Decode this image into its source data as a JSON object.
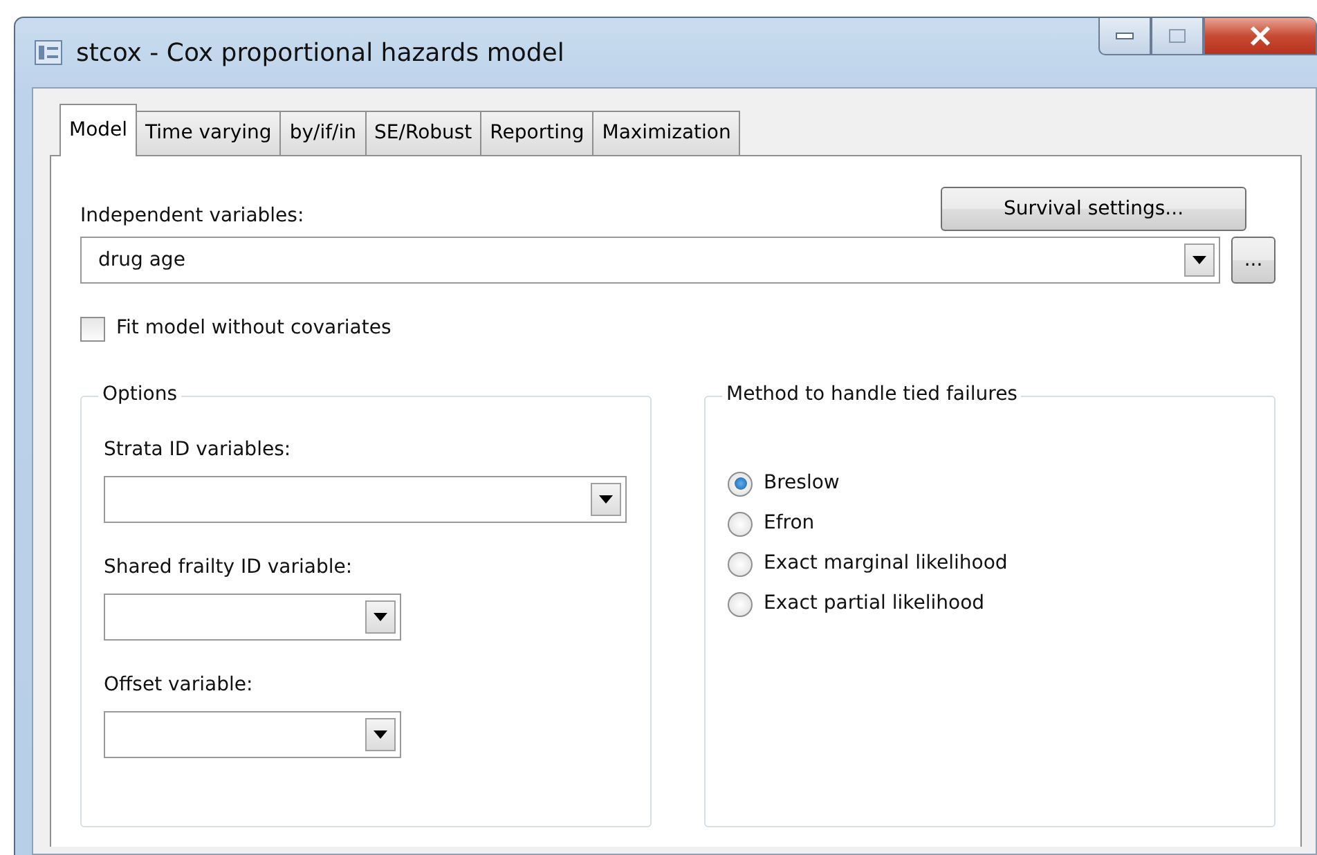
{
  "window": {
    "title": "stcox - Cox proportional hazards model"
  },
  "tabs": [
    {
      "label": "Model",
      "selected": true
    },
    {
      "label": "Time varying",
      "selected": false
    },
    {
      "label": "by/if/in",
      "selected": false
    },
    {
      "label": "SE/Robust",
      "selected": false
    },
    {
      "label": "Reporting",
      "selected": false
    },
    {
      "label": "Maximization",
      "selected": false
    }
  ],
  "independent_variables": {
    "label": "Independent variables:",
    "value": "drug age"
  },
  "survival_settings_button": "Survival settings...",
  "browse_button": "...",
  "fit_without_covariates": {
    "label": "Fit model without covariates",
    "checked": false
  },
  "options": {
    "title": "Options",
    "fields": [
      {
        "label": "Strata ID variables:",
        "wide": true
      },
      {
        "label": "Shared frailty ID variable:",
        "wide": false
      },
      {
        "label": "Offset variable:",
        "wide": false
      }
    ]
  },
  "ties": {
    "title": "Method to handle tied failures",
    "choices": [
      {
        "label": "Breslow",
        "selected": true
      },
      {
        "label": "Efron",
        "selected": false
      },
      {
        "label": "Exact marginal likelihood",
        "selected": false
      },
      {
        "label": "Exact partial likelihood",
        "selected": false
      }
    ]
  }
}
